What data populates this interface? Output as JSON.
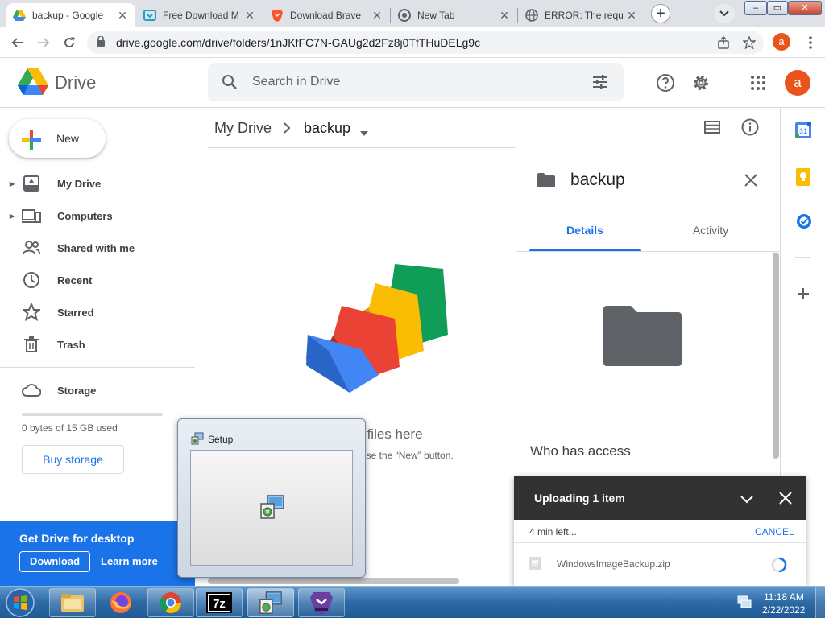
{
  "browser": {
    "tabs": [
      {
        "title": "backup - Google",
        "icon": "google-drive-icon"
      },
      {
        "title": "Free Download M",
        "icon": "download-site-icon"
      },
      {
        "title": "Download Brave",
        "icon": "brave-icon"
      },
      {
        "title": "New Tab",
        "icon": "chrome-icon"
      },
      {
        "title": "ERROR: The requ",
        "icon": "globe-icon"
      }
    ],
    "new_tab": "+",
    "url": "drive.google.com/drive/folders/1nJKfFC7N-GAUg2d2Fz8j0TfTHuDELg9c",
    "profile_initial": "a",
    "window_controls": {
      "minimize": "–",
      "maximize": "▭",
      "close": "✕"
    }
  },
  "header": {
    "app_name": "Drive",
    "search_placeholder": "Search in Drive",
    "avatar_initial": "a"
  },
  "sidebar": {
    "new_label": "New",
    "items": [
      {
        "label": "My Drive",
        "icon": "my-drive-icon",
        "expandable": true
      },
      {
        "label": "Computers",
        "icon": "computers-icon",
        "expandable": true
      },
      {
        "label": "Shared with me",
        "icon": "shared-icon",
        "expandable": false
      },
      {
        "label": "Recent",
        "icon": "clock-icon",
        "expandable": false
      },
      {
        "label": "Starred",
        "icon": "star-icon",
        "expandable": false
      },
      {
        "label": "Trash",
        "icon": "trash-icon",
        "expandable": false
      }
    ],
    "storage_label": "Storage",
    "storage_used": "0 bytes of 15 GB used",
    "storage_fraction": 0,
    "buy_storage": "Buy storage",
    "promo": {
      "title": "Get Drive for desktop",
      "download": "Download",
      "learn_more": "Learn more"
    }
  },
  "main": {
    "breadcrumb_root": "My Drive",
    "breadcrumb_current": "backup",
    "empty_title": "Drop files here",
    "empty_subtitle": "or use the “New” button."
  },
  "details": {
    "title": "backup",
    "tabs": [
      "Details",
      "Activity"
    ],
    "active_tab": "Details",
    "who_has_access": "Who has access"
  },
  "upload": {
    "title": "Uploading 1 item",
    "time_left": "4 min left...",
    "cancel": "CANCEL",
    "file_name": "WindowsImageBackup.zip"
  },
  "setup_dialog": {
    "title": "Setup"
  },
  "taskbar": {
    "apps": [
      "windows-explorer",
      "firefox",
      "chrome",
      "7-zip",
      "setup",
      "brave-nightly"
    ],
    "time": "11:18 AM",
    "date": "2/22/2022"
  },
  "colors": {
    "accent": "#1a73e8",
    "avatar": "#e8541c",
    "toast_header": "#323232",
    "taskbar": "#2d6aa6"
  }
}
